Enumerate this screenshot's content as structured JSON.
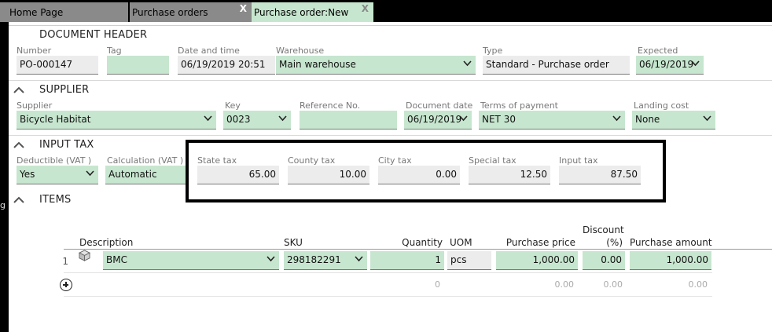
{
  "tabs": [
    {
      "label": "Home Page",
      "closable": false
    },
    {
      "label": "Purchase orders",
      "closable": true
    },
    {
      "label": "Purchase order:New",
      "closable": true,
      "active": true
    }
  ],
  "close_glyph": "X",
  "sidebar_glyph": "g",
  "header": {
    "title": "DOCUMENT HEADER",
    "number": {
      "label": "Number",
      "value": "PO-000147"
    },
    "tag": {
      "label": "Tag",
      "value": ""
    },
    "datetime": {
      "label": "Date and time",
      "value": "06/19/2019 20:51"
    },
    "warehouse": {
      "label": "Warehouse",
      "value": "Main warehouse"
    },
    "type": {
      "label": "Type",
      "value": "Standard - Purchase order"
    },
    "expected": {
      "label": "Expected",
      "value": "06/19/2019"
    }
  },
  "supplier": {
    "title": "SUPPLIER",
    "supplier": {
      "label": "Supplier",
      "value": "Bicycle Habitat"
    },
    "key": {
      "label": "Key",
      "value": "0023"
    },
    "reference": {
      "label": "Reference No.",
      "value": ""
    },
    "document_date": {
      "label": "Document date",
      "value": "06/19/2019"
    },
    "terms": {
      "label": "Terms of payment",
      "value": "NET 30"
    },
    "landing_cost": {
      "label": "Landing cost",
      "value": "None"
    }
  },
  "input_tax": {
    "title": "INPUT TAX",
    "deductible": {
      "label": "Deductible (VAT )",
      "value": "Yes"
    },
    "calculation": {
      "label": "Calculation (VAT )",
      "value": "Automatic"
    },
    "state_tax": {
      "label": "State tax",
      "value": "65.00"
    },
    "county_tax": {
      "label": "County tax",
      "value": "10.00"
    },
    "city_tax": {
      "label": "City tax",
      "value": "0.00"
    },
    "special_tax": {
      "label": "Special tax",
      "value": "12.50"
    },
    "input_tax_total": {
      "label": "Input tax",
      "value": "87.50"
    }
  },
  "items": {
    "title": "ITEMS",
    "columns": {
      "description": "Description",
      "sku": "SKU",
      "quantity": "Quantity",
      "uom": "UOM",
      "purchase_price": "Purchase price",
      "discount_line1": "Discount",
      "discount_line2": "(%)",
      "purchase_amount": "Purchase amount"
    },
    "rows": [
      {
        "num": "1",
        "description": "BMC",
        "sku": "298182291",
        "quantity": "1",
        "uom": "pcs",
        "price": "1,000.00",
        "discount": "0.00",
        "amount": "1,000.00"
      }
    ],
    "new_row": {
      "quantity": "0",
      "price": "0.00",
      "discount": "0.00",
      "amount": "0.00"
    }
  },
  "colors": {
    "field_green": "#c7e6cf",
    "field_gray": "#ececec",
    "tab_gray": "#8a8a8a"
  }
}
